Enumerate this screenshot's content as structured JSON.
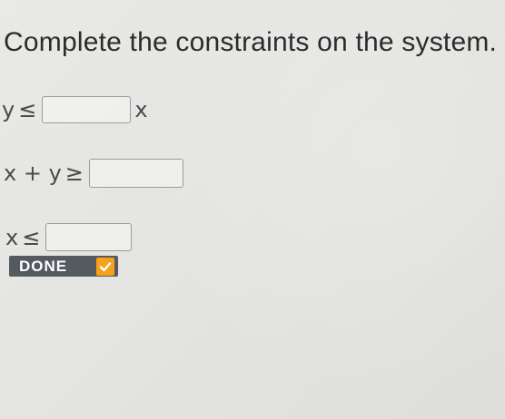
{
  "page": {
    "title": "Complete the constraints on the system."
  },
  "constraints": [
    {
      "left": "y",
      "symbol": "≤",
      "right": "x"
    },
    {
      "left": "x + y",
      "symbol": "≥"
    },
    {
      "left": "x",
      "symbol": "≤"
    }
  ],
  "done_button": {
    "label": "DONE",
    "icon": "check-icon",
    "icon_color": "#f6a11a",
    "background": "#555a60"
  }
}
